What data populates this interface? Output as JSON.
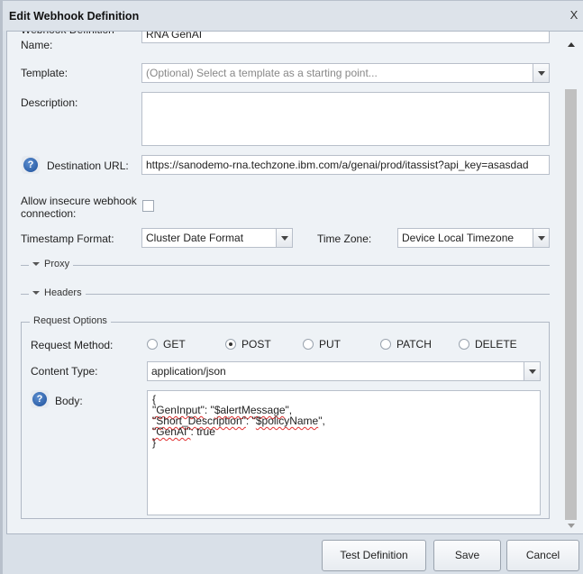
{
  "dialog": {
    "title": "Edit Webhook Definition",
    "close_label": "X"
  },
  "form": {
    "name": {
      "label_top": "Webhook Definition",
      "label": "Name:",
      "value": "RNA GenAI"
    },
    "template": {
      "label": "Template:",
      "placeholder": "(Optional) Select a template as a starting point..."
    },
    "description": {
      "label": "Description:",
      "value": ""
    },
    "destination_url": {
      "label": "Destination URL:",
      "value": "https://sanodemo-rna.techzone.ibm.com/a/genai/prod/itassist?api_key=asasdad"
    },
    "allow_insecure": {
      "label_line1": "Allow insecure webhook",
      "label_line2": "connection:",
      "checked": false
    },
    "timestamp_format": {
      "label": "Timestamp Format:",
      "value": "Cluster Date Format"
    },
    "time_zone": {
      "label": "Time Zone:",
      "value": "Device Local Timezone"
    },
    "proxy": {
      "label": "Proxy",
      "expanded": false
    },
    "headers": {
      "label": "Headers",
      "expanded": false
    }
  },
  "request_options": {
    "legend": "Request Options",
    "method": {
      "label": "Request Method:",
      "options": [
        "GET",
        "POST",
        "PUT",
        "PATCH",
        "DELETE"
      ],
      "selected": "POST"
    },
    "content_type": {
      "label": "Content Type:",
      "value": "application/json"
    },
    "body": {
      "label": "Body:",
      "lines": [
        "{",
        "\"GenInput\": \"$alertMessage\",",
        "\"Short_Description\": \"$policyName\",",
        "\"GenAI\": true",
        "}"
      ]
    }
  },
  "footer": {
    "test_label": "Test Definition",
    "save_label": "Save",
    "cancel_label": "Cancel"
  }
}
